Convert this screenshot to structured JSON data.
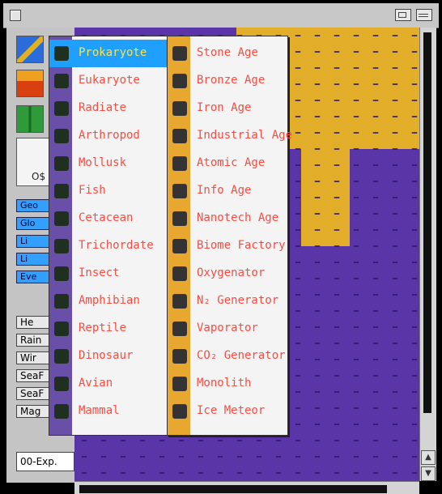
{
  "palette": {
    "tool4_label": "O$",
    "blue_buttons": [
      "Geo",
      "Glo",
      "Li",
      "Li",
      "Eve"
    ],
    "gray_buttons": [
      "He",
      "Rain",
      "Wir",
      "SeaF",
      "SeaF",
      "Mag"
    ],
    "exp_label": "00-Exp."
  },
  "life_menu": {
    "items": [
      "Prokaryote",
      "Eukaryote",
      "Radiate",
      "Arthropod",
      "Mollusk",
      "Fish",
      "Cetacean",
      "Trichordate",
      "Insect",
      "Amphibian",
      "Reptile",
      "Dinosaur",
      "Avian",
      "Mammal"
    ],
    "selected_index": 0
  },
  "tech_menu": {
    "items": [
      "Stone Age",
      "Bronze Age",
      "Iron Age",
      "Industrial Age",
      "Atomic Age",
      "Info Age",
      "Nanotech Age",
      "Biome Factory",
      "Oxygenator",
      "N₂ Generator",
      "Vaporator",
      "CO₂ Generator",
      "Monolith",
      "Ice Meteor"
    ]
  },
  "colors": {
    "menu_text": "#ff4a40",
    "menu_highlight": "#1fa0ff",
    "ocean": "#5a35a8",
    "land": "#e3ae2a"
  }
}
